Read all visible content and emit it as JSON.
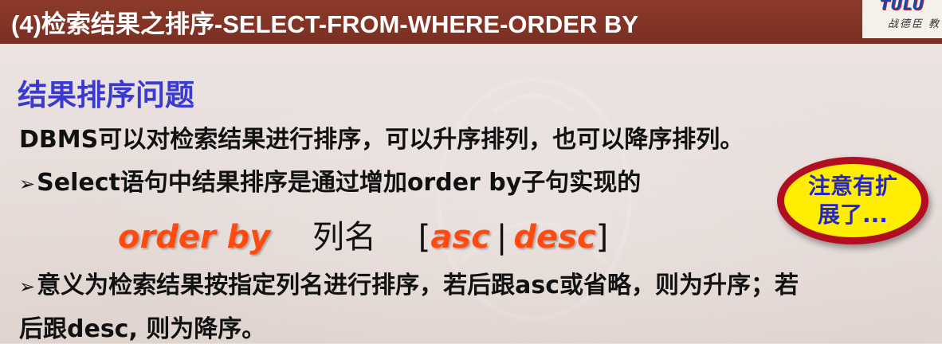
{
  "header": {
    "title": "(4)检索结果之排序-SELECT-FROM-WHERE-ORDER BY",
    "logo_mark": "TULU",
    "logo_sub": "战德臣 教"
  },
  "content": {
    "heading": "结果排序问题",
    "line1": "DBMS可以对检索结果进行排序，可以升序排列，也可以降序排列。",
    "bullet_symbol": "➢",
    "line2": "Select语句中结果排序是通过增加order by子句实现的",
    "syntax": {
      "keyword": "order by",
      "column": "列名",
      "open_bracket": "[",
      "asc": "asc",
      "separator": "|",
      "desc": "desc",
      "close_bracket": "]"
    },
    "line3": "意义为检索结果按指定列名进行排序，若后跟asc或省略，则为升序；若",
    "line4": "后跟desc, 则为降序。"
  },
  "callout": {
    "line1": "注意有扩",
    "line2": "展了..."
  },
  "colors": {
    "title_bar": "#7a2f22",
    "heading": "#3a3ad0",
    "keyword": "#ff4a10",
    "callout_fill": "#ffee00",
    "callout_border": "#b20e22",
    "callout_text": "#2626c8"
  }
}
